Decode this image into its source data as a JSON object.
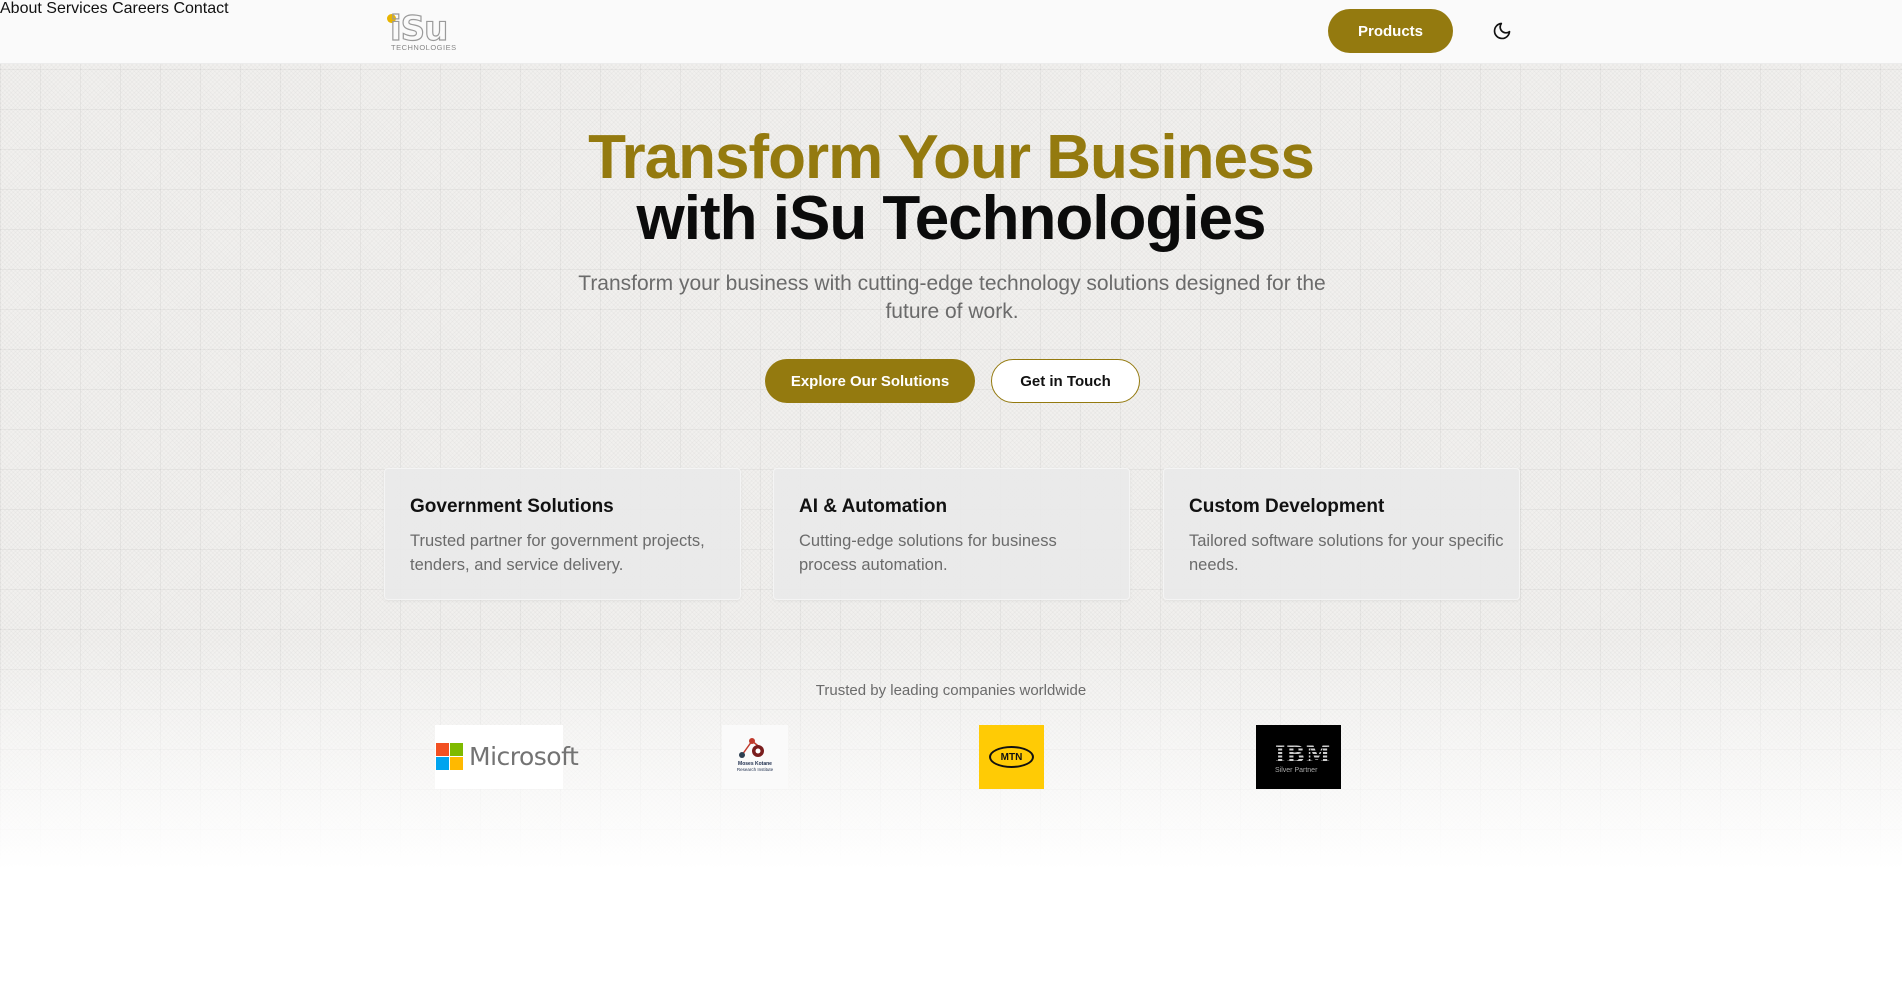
{
  "header": {
    "logo": {
      "word": "iSu",
      "sub": "TECHNOLOGIES"
    },
    "nav": [
      "About",
      "Services",
      "Careers",
      "Contact"
    ],
    "products_label": "Products",
    "theme_icon": "moon-icon"
  },
  "hero": {
    "title_line1": "Transform Your Business",
    "title_line2": "with iSu Technologies",
    "subtitle": "Transform your business with cutting-edge technology solutions designed for the future of work.",
    "primary_cta": "Explore Our Solutions",
    "secondary_cta": "Get in Touch"
  },
  "features": [
    {
      "title": "Government Solutions",
      "description": "Trusted partner for government projects, tenders, and service delivery."
    },
    {
      "title": "AI & Automation",
      "description": "Cutting-edge solutions for business process automation."
    },
    {
      "title": "Custom Development",
      "description": "Tailored software solutions for your specific needs."
    }
  ],
  "trusted": {
    "label": "Trusted by leading companies worldwide",
    "logos": [
      {
        "name": "Microsoft",
        "text": "Microsoft"
      },
      {
        "name": "Moses Kotane Research Institute",
        "text": "Moses Kotane Research Institute"
      },
      {
        "name": "MTN",
        "text": "MTN"
      },
      {
        "name": "IBM Silver Partner",
        "text": "IBM",
        "sub": "Silver Partner"
      }
    ]
  },
  "colors": {
    "accent": "#947a0f",
    "microsoft": [
      "#f25022",
      "#7fba00",
      "#00a4ef",
      "#ffb900"
    ],
    "mtn": "#ffcb05"
  }
}
